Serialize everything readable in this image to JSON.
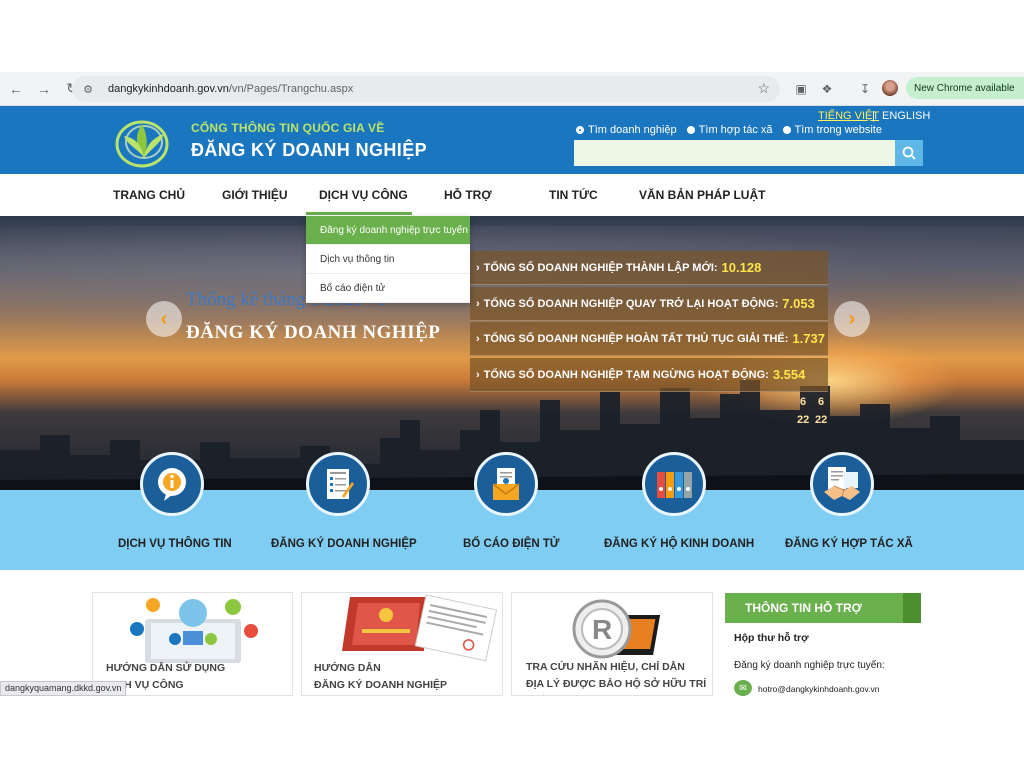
{
  "browser": {
    "url_domain": "dangkykinhdoanh.gov.vn",
    "url_path": "/vn/Pages/Trangchu.aspx",
    "update_label": "New Chrome available",
    "status_url": "dangkyquamang.dkkd.gov.vn"
  },
  "header": {
    "logo_top": "CỔNG THÔNG TIN QUỐC GIA VỀ",
    "logo_main": "ĐĂNG KÝ DOANH NGHIỆP",
    "lang_vi": "TIẾNG VIỆT",
    "lang_sep": "|",
    "lang_en": "ENGLISH",
    "search_options": [
      "Tìm doanh nghiệp",
      "Tìm hợp tác xã",
      "Tìm trong website"
    ],
    "search_value": ""
  },
  "nav": {
    "items": [
      "TRANG CHỦ",
      "GIỚI THIỆU",
      "DỊCH VỤ CÔNG",
      "HỖ TRỢ",
      "TIN TỨC",
      "VĂN BẢN PHÁP LUẬT"
    ],
    "active": "DỊCH VỤ CÔNG",
    "dropdown": [
      "Đăng ký doanh nghiệp trực tuyến",
      "Dịch vụ thông tin",
      "Bố cáo điện tử"
    ]
  },
  "banner": {
    "title": "Thống kê tháng 1/2025 về",
    "subtitle": "ĐĂNG KÝ DOANH NGHIỆP",
    "stats": [
      {
        "label": "TỔNG SỐ DOANH NGHIỆP THÀNH LẬP MỚI:",
        "value": "10.128"
      },
      {
        "label": "TỔNG SỐ DOANH NGHIỆP QUAY TRỞ LẠI HOẠT ĐỘNG:",
        "value": "7.053"
      },
      {
        "label": "TỔNG SỐ DOANH NGHIỆP HOÀN TẤT THỦ TỤC GIẢI THỂ:",
        "value": "1.737"
      },
      {
        "label": "TỔNG SỐ DOANH NGHIỆP TẠM NGỪNG HOẠT ĐỘNG:",
        "value": "3.554"
      }
    ],
    "building_signs": [
      "6",
      "6",
      "22",
      "22"
    ]
  },
  "services": [
    {
      "label": "DỊCH VỤ THÔNG TIN",
      "icon": "info-icon"
    },
    {
      "label": "ĐĂNG KÝ DOANH NGHIỆP",
      "icon": "document-icon"
    },
    {
      "label": "BỐ CÁO ĐIỆN TỬ",
      "icon": "envelope-icon"
    },
    {
      "label": "ĐĂNG KÝ HỘ KINH DOANH",
      "icon": "binders-icon"
    },
    {
      "label": "ĐĂNG KÝ HỢP TÁC XÃ",
      "icon": "handshake-icon"
    }
  ],
  "cards": [
    {
      "line1": "HƯỚNG DẪN SỬ DỤNG",
      "line2": "DỊCH VỤ CÔNG"
    },
    {
      "line1": "HƯỚNG DẪN",
      "line2": "ĐĂNG KÝ DOANH NGHIỆP"
    },
    {
      "line1": "TRA CỨU NHÃN HIỆU, CHỈ DẪN",
      "line2": "ĐỊA LÝ ĐƯỢC BẢO HỘ SỞ HỮU TRÍ TUỆ"
    }
  ],
  "card_images": {
    "cert_text": "GIẤY CHỨNG NHẬN ĐĂNG KÝ DOANH NGHIỆP",
    "doc_title": "ĐĂNG KÝ"
  },
  "support": {
    "heading": "THÔNG TIN HỖ TRỢ",
    "title": "Hộp thư hỗ trợ",
    "line": "Đăng ký doanh nghiệp trực tuyến:",
    "email": "hotro@dangkykinhdoanh.gov.vn"
  },
  "colors": {
    "header_blue": "#1a76be",
    "accent_green": "#6ab04c",
    "service_band": "#7fcdf2",
    "stat_value": "#ffe44a"
  }
}
